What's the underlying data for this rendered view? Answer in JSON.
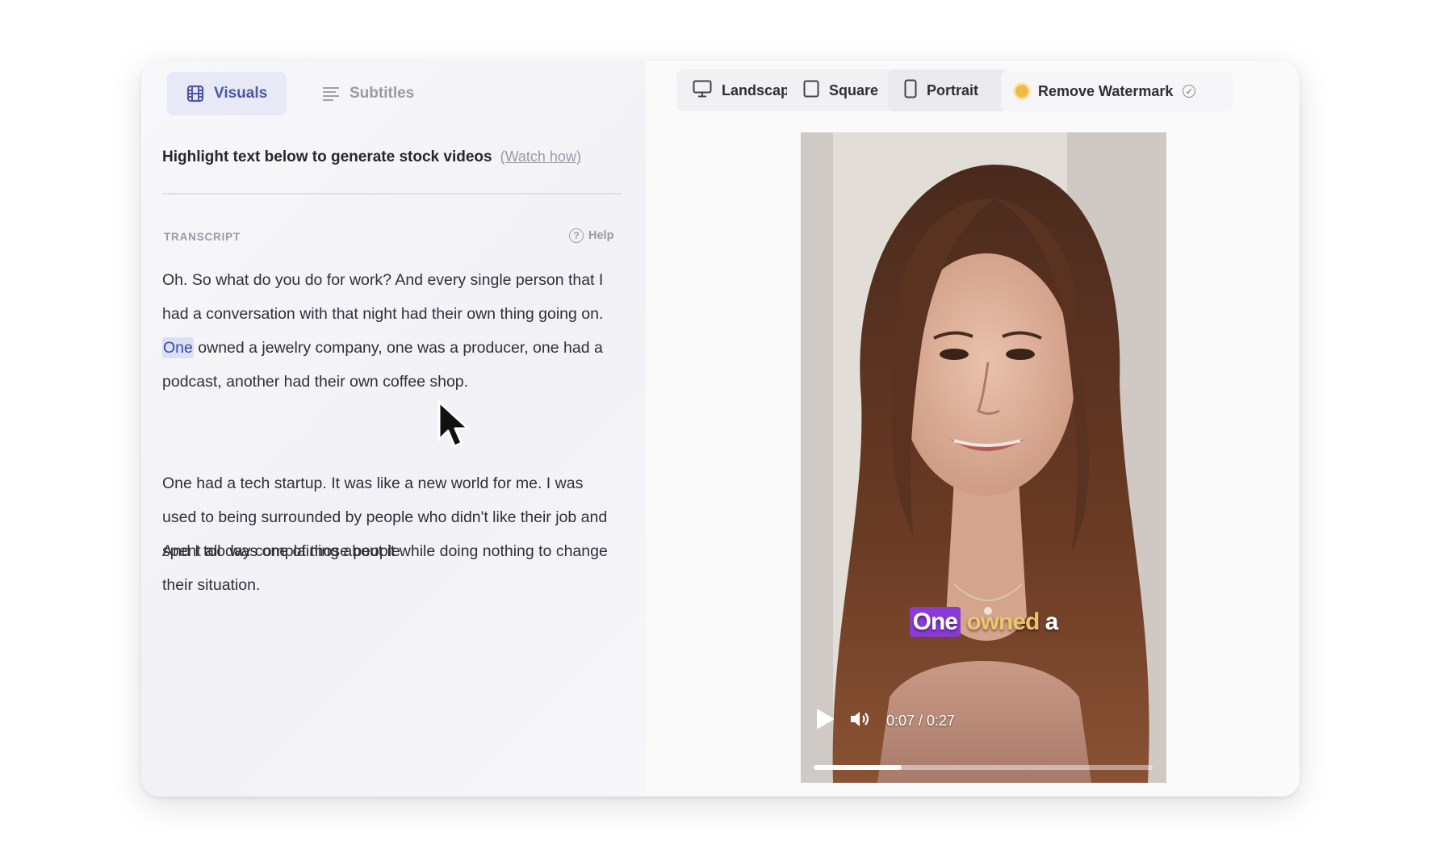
{
  "tabs": {
    "visuals_label": "Visuals",
    "subtitles_label": "Subtitles"
  },
  "instruction": {
    "text": "Highlight text below to generate stock videos",
    "link": "(Watch how)"
  },
  "transcript": {
    "label": "TRANSCRIPT",
    "help": "Help",
    "help_icon": "?",
    "p1_a": "Oh. So what do you do for work? And every single person that I had a conversation with that night had their own thing going on. ",
    "p1_highlight": "One",
    "p1_b": " owned a jewelry company, one was a producer, one had a podcast, another had their own coffee shop.",
    "p2": "One had a tech startup. It was like a new world for me. I was used to being surrounded by people who didn't like their job and spent all day complaining about it while doing nothing to change their situation.",
    "p3": "And I too was one of those people."
  },
  "orientation": {
    "landscape": "Landscape",
    "square": "Square",
    "portrait": "Portrait"
  },
  "watermark": {
    "label": "Remove Watermark",
    "check": "✓"
  },
  "player": {
    "caption_one": "One",
    "caption_owned": "owned",
    "caption_a": "a",
    "time": "0:07 / 0:27",
    "progress": 0.26
  },
  "colors": {
    "accent": "#4f56a8",
    "highlight_bg": "#dbe0f7",
    "caption_highlight": "#8a3ad6",
    "caption_word": "#f1c46b",
    "watermark_dot": "#f4b942"
  },
  "icons": [
    "film-icon",
    "lines-icon",
    "help-icon",
    "monitor-icon",
    "square-icon",
    "phone-icon",
    "sun-icon",
    "check-circle-icon",
    "play-icon",
    "volume-icon",
    "cursor-icon"
  ]
}
